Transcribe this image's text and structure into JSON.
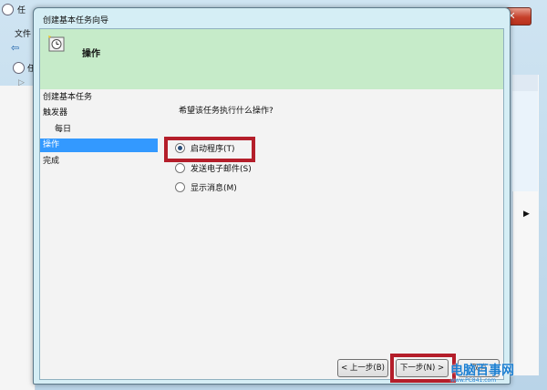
{
  "parent_window": {
    "title_fragment": "任",
    "menu_fragment": "文件",
    "tree_fragment": "任"
  },
  "dialog": {
    "title": "创建基本任务向导",
    "header_title": "操作",
    "steps": [
      {
        "label": "创建基本任务",
        "level": 0,
        "active": false
      },
      {
        "label": "触发器",
        "level": 0,
        "active": false
      },
      {
        "label": "每日",
        "level": 1,
        "active": false
      },
      {
        "label": "操作",
        "level": 0,
        "active": true
      },
      {
        "label": "完成",
        "level": 0,
        "active": false
      }
    ],
    "question": "希望该任务执行什么操作?",
    "options": [
      {
        "label": "启动程序(T)",
        "selected": true
      },
      {
        "label": "发送电子邮件(S)",
        "selected": false
      },
      {
        "label": "显示消息(M)",
        "selected": false
      }
    ],
    "buttons": {
      "back": "< 上一步(B)",
      "next": "下一步(N) >",
      "cancel": "取消"
    }
  },
  "window_controls": {
    "close": "✕",
    "minimize": "‒"
  },
  "watermark": {
    "text": "电脑百事网",
    "url": "www.PC841.com"
  },
  "colors": {
    "header_bg": "#c6ebc9",
    "active_step": "#3399ff",
    "highlight_box": "#b41e2a"
  }
}
